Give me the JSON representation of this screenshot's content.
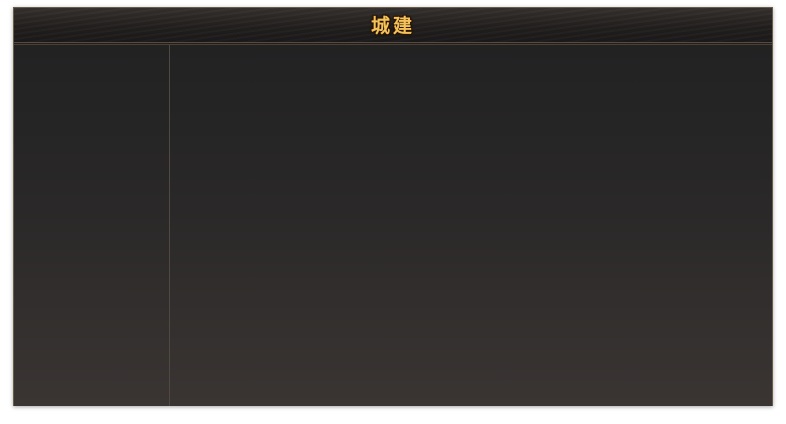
{
  "window": {
    "title": "城建"
  },
  "colors": {
    "title_text": "#f4c25a",
    "frame_border": "#6b5b4a",
    "panel_top": "#222223",
    "panel_bottom": "#3a3533"
  }
}
